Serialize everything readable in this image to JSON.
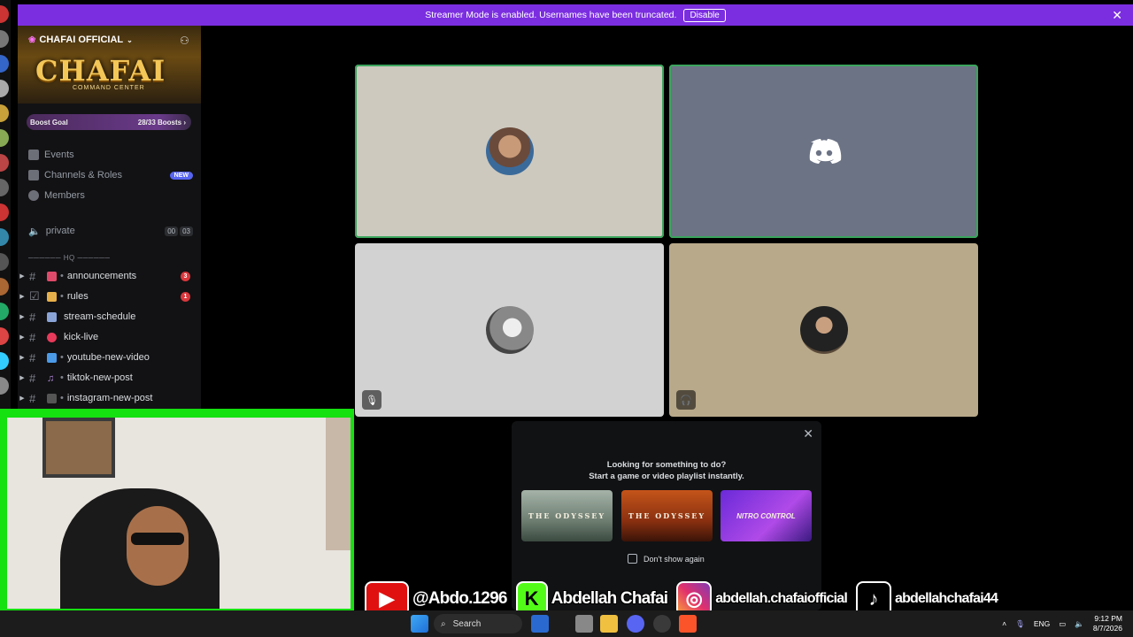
{
  "banner": {
    "message": "Streamer Mode is enabled. Usernames have been truncated.",
    "button": "Disable"
  },
  "server": {
    "name": "CHAFAI OFFICIAL",
    "logo_text": "CHAFAI",
    "logo_sub": "COMMAND CENTER"
  },
  "boost": {
    "label": "Boost Goal",
    "progress": "28/33 Boosts"
  },
  "nav": {
    "events": "Events",
    "channels_roles": "Channels & Roles",
    "new_badge": "NEW",
    "members": "Members"
  },
  "voice_channel": {
    "name": "private",
    "count_a": "00",
    "count_b": "03"
  },
  "category": "────── HQ ──────",
  "channels": [
    {
      "name": "announcements",
      "badge": "3"
    },
    {
      "name": "rules",
      "badge": "1"
    },
    {
      "name": "stream-schedule",
      "badge": ""
    },
    {
      "name": "kick-live",
      "badge": ""
    },
    {
      "name": "youtube-new-video",
      "badge": ""
    },
    {
      "name": "tiktok-new-post",
      "badge": ""
    },
    {
      "name": "instagram-new-post",
      "badge": ""
    }
  ],
  "activity": {
    "line1": "Looking for something to do?",
    "line2": "Start a game or video playlist instantly.",
    "cards": [
      "THE ODYSSEY",
      "THE ODYSSEY",
      "NITRO CONTROL"
    ],
    "dont_show": "Don't show again"
  },
  "socials": {
    "youtube": "@Abdo.1296",
    "kick": "Abdellah Chafai",
    "instagram": "abdellah.chafaiofficial",
    "tiktok": "abdellahchafai44"
  },
  "taskbar": {
    "search": "Search",
    "lang": "ENG",
    "time": "9:12 PM",
    "date": "8/7/2026"
  },
  "colors": {
    "banner": "#7b2ee0",
    "speaking": "#3ba55d",
    "mention": "#da373c",
    "blurple": "#5865f2",
    "cam_border": "#15e010"
  }
}
